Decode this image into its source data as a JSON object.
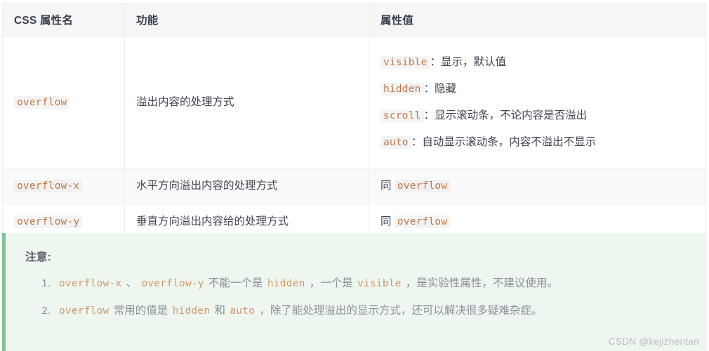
{
  "table": {
    "headers": [
      "CSS 属性名",
      "功能",
      "属性值"
    ],
    "rows": [
      {
        "prop": "overflow",
        "desc": "溢出内容的处理方式",
        "values": [
          {
            "code": "visible",
            "sep": "：",
            "text": "显示，默认值"
          },
          {
            "code": "hidden",
            "sep": "：",
            "text": "隐藏"
          },
          {
            "code": "scroll",
            "sep": "：",
            "text": "显示滚动条，不论内容是否溢出"
          },
          {
            "code": "auto",
            "sep": "：",
            "text": "自动显示滚动条，内容不溢出不显示"
          }
        ]
      },
      {
        "prop": "overflow-x",
        "desc": "水平方向溢出内容的处理方式",
        "same_prefix": "同",
        "same_code": "overflow"
      },
      {
        "prop": "overflow-y",
        "desc": "垂直方向溢出内容给的处理方式",
        "same_prefix": "同",
        "same_code": "overflow"
      }
    ]
  },
  "notice": {
    "title": "注意:",
    "items": [
      {
        "p1": "overflow-x",
        "t1": " 、 ",
        "p2": "overflow-y",
        "t2": " 不能一个是 ",
        "p3": "hidden",
        "t3": " ，一个是 ",
        "p4": "visible",
        "t4": " ，是实验性属性，不建议使用。"
      },
      {
        "p1": "overflow",
        "t1": " 常用的值是 ",
        "p2": "hidden",
        "t2": " 和 ",
        "p3": "auto",
        "t3": " ，除了能处理溢出的显示方式，还可以解决很多疑难杂症。",
        "p4": "",
        "t4": ""
      }
    ]
  },
  "watermark": "CSDN @kejizhentan",
  "colors": {
    "code_text": "#c0794a",
    "notice_border": "#7fc497",
    "notice_bg": "#edf6ef",
    "header_bg": "#f5f6f7",
    "zebra_bg": "#fafafa"
  }
}
